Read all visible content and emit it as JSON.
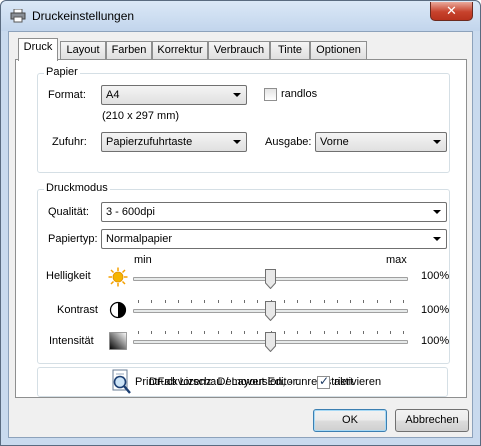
{
  "window": {
    "title": "Druckeinstellungen",
    "close_glyph": "✕"
  },
  "tabs": [
    {
      "label": "Druck",
      "active": true
    },
    {
      "label": "Layout"
    },
    {
      "label": "Farben"
    },
    {
      "label": "Korrektur"
    },
    {
      "label": "Verbrauch"
    },
    {
      "label": "Tinte"
    },
    {
      "label": "Optionen"
    }
  ],
  "papier": {
    "group_label": "Papier",
    "format_label": "Format:",
    "format_value": "A4",
    "format_size": "(210 x 297 mm)",
    "randlos_label": "randlos",
    "randlos_checked": false,
    "zufuhr_label": "Zufuhr:",
    "zufuhr_value": "Papierzufuhrtaste",
    "ausgabe_label": "Ausgabe:",
    "ausgabe_value": "Vorne"
  },
  "druckmodus": {
    "group_label": "Druckmodus",
    "qualitaet_label": "Qualität:",
    "qualitaet_value": "3 - 600dpi",
    "papiertyp_label": "Papiertyp:",
    "papiertyp_value": "Normalpapier",
    "min_label": "min",
    "max_label": "max",
    "sliders": [
      {
        "label": "Helligkeit",
        "value_text": "100%",
        "level": 0.5,
        "icon": "sun-icon"
      },
      {
        "label": "Kontrast",
        "value_text": "100%",
        "level": 0.5,
        "icon": "contrast-icon"
      },
      {
        "label": "Intensität",
        "value_text": "100%",
        "level": 0.5,
        "icon": "intensity-icon"
      }
    ]
  },
  "license_text": "PrintFab Lizenz: Demoversion,  - unregistriert",
  "preview": {
    "label": "Druckvorschau / Layout Editor:",
    "checkbox_label": "aktivieren",
    "checked": true
  },
  "buttons": {
    "ok": "OK",
    "cancel": "Abbrechen"
  },
  "colors": {
    "sun": "#f5b400",
    "title_bg": "#c9daee",
    "close_red": "#c7422c"
  }
}
